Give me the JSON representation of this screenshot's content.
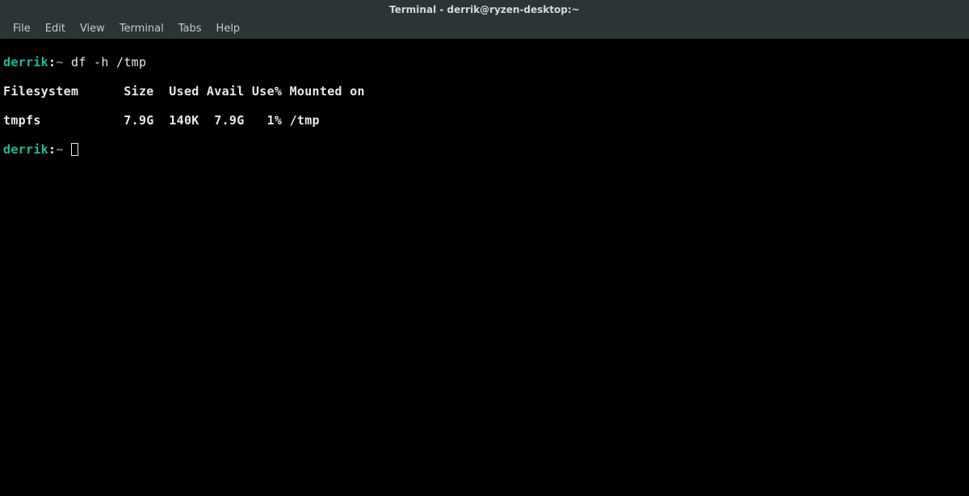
{
  "window": {
    "title": "Terminal - derrik@ryzen-desktop:~"
  },
  "menubar": {
    "items": [
      "File",
      "Edit",
      "View",
      "Terminal",
      "Tabs",
      "Help"
    ]
  },
  "terminal": {
    "prompt1": {
      "user": "derrik",
      "sep": ":",
      "path": "~",
      "command": "df -h /tmp"
    },
    "output_header": "Filesystem      Size  Used Avail Use% Mounted on",
    "output_row": "tmpfs           7.9G  140K  7.9G   1% /tmp",
    "prompt2": {
      "user": "derrik",
      "sep": ":",
      "path": "~"
    }
  },
  "chart_data": {
    "type": "table",
    "title": "df -h /tmp",
    "columns": [
      "Filesystem",
      "Size",
      "Used",
      "Avail",
      "Use%",
      "Mounted on"
    ],
    "rows": [
      {
        "Filesystem": "tmpfs",
        "Size": "7.9G",
        "Used": "140K",
        "Avail": "7.9G",
        "Use%": "1%",
        "Mounted on": "/tmp"
      }
    ]
  }
}
